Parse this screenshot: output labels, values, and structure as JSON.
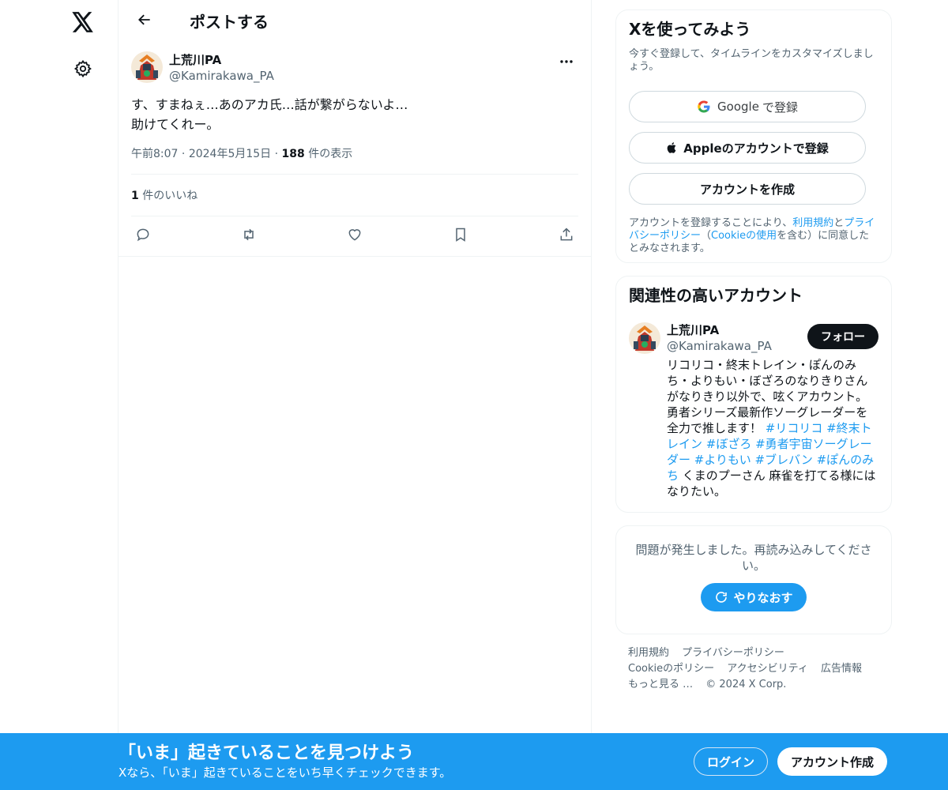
{
  "colors": {
    "accent": "#1d9bf0",
    "text": "#0f1419",
    "muted": "#536471",
    "border": "#eff3f4"
  },
  "nav": {
    "logo_icon": "x-logo-icon",
    "settings_icon": "gear-icon"
  },
  "header": {
    "back_icon": "arrow-left-icon",
    "title": "ポストする"
  },
  "post": {
    "author_name": "上荒川PA",
    "author_handle": "@Kamirakawa_PA",
    "text_line1": "す、すまねぇ…あのアカ氏…話が繋がらないよ…",
    "text_line2": "助けてくれー。",
    "time": "午前8:07",
    "date": "2024年5月15日",
    "view_count": "188",
    "view_label": "件の表示",
    "like_count": "1",
    "like_label": "件のいいね",
    "actions": [
      "reply-icon",
      "repost-icon",
      "like-icon",
      "bookmark-icon",
      "share-icon"
    ]
  },
  "signup": {
    "title": "Xを使ってみよう",
    "subtitle": "今すぐ登録して、タイムラインをカスタマイズしましょう。",
    "google_brand": "Google",
    "google_suffix": "で登録",
    "apple_label": "Appleのアカウントで登録",
    "create_label": "アカウントを作成",
    "legal_1": "アカウントを登録することにより、",
    "legal_terms": "利用規約",
    "legal_and": "と",
    "legal_privacy": "プライバシーポリシー",
    "legal_paren_open": "（",
    "legal_cookie": "Cookieの使用",
    "legal_2": "を含む）に同意したとみなされます。"
  },
  "related": {
    "title": "関連性の高いアカウント",
    "name": "上荒川PA",
    "handle": "@Kamirakawa_PA",
    "follow_label": "フォロー",
    "bio_text": "リコリコ・終末トレイン・ぽんのみち・よりもい・ぼざろのなりきりさんがなりきり以外で、呟くアカウント。勇者シリーズ最新作ソーグレーダーを全力で推します！ ",
    "bio_tags": "#リコリコ #終末トレイン #ぼざろ #勇者宇宙ソーグレーダー #よりもい #ブレバン #ぽんのみち",
    "bio_end": " くまのプーさん 麻雀を打てる様にはなりたい。"
  },
  "error": {
    "message": "問題が発生しました。再読み込みしてください。",
    "retry_label": "やりなおす"
  },
  "footer": {
    "terms": "利用規約",
    "privacy": "プライバシーポリシー",
    "cookie": "Cookieのポリシー",
    "accessibility": "アクセシビリティ",
    "ads": "広告情報",
    "more": "もっと見る …",
    "copyright": "© 2024 X Corp."
  },
  "bottom_bar": {
    "title": "「いま」起きていることを見つけよう",
    "subtitle": "Xなら、「いま」起きていることをいち早くチェックできます。",
    "login_label": "ログイン",
    "signup_label": "アカウント作成"
  }
}
